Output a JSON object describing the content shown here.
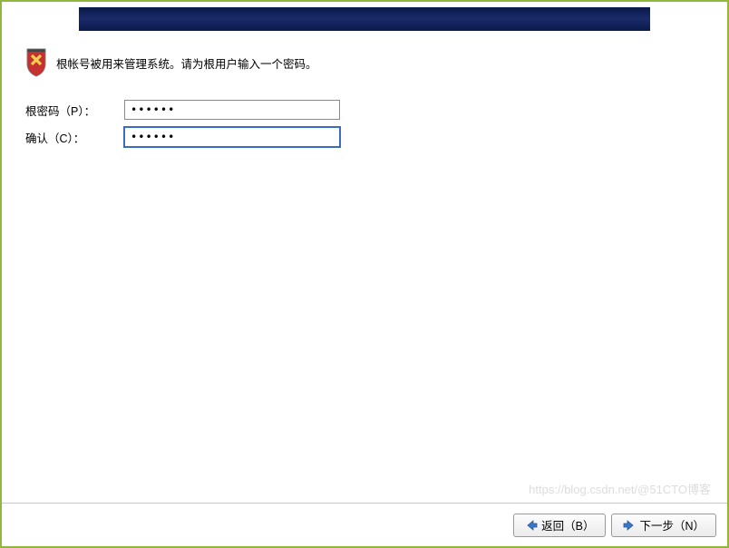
{
  "header": {
    "description": "根帐号被用来管理系统。请为根用户输入一个密码。"
  },
  "form": {
    "password_label": "根密码（P）：",
    "password_value": "••••••",
    "confirm_label": "确认（C）：",
    "confirm_value": "••••••"
  },
  "buttons": {
    "back_label": "返回（B）",
    "next_label": "下一步（N）"
  },
  "watermark": "https://blog.csdn.net/@51CTO博客"
}
